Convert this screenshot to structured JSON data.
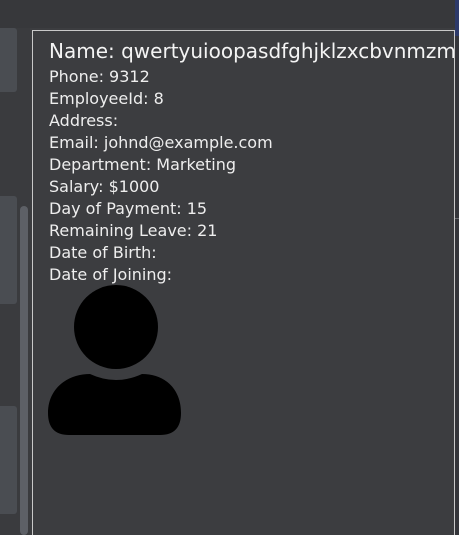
{
  "employee": {
    "name_label": "Name: ",
    "name": "qwertyuioopasdfghjklzxcbvnmzmzxcvbnmasdfghjkl",
    "fields": [
      {
        "label": "Phone: ",
        "value": "9312"
      },
      {
        "label": "EmployeeId: ",
        "value": "8"
      },
      {
        "label": "Address: ",
        "value": ""
      },
      {
        "label": "Email: ",
        "value": "johnd@example.com"
      },
      {
        "label": "Department: ",
        "value": "Marketing"
      },
      {
        "label": "Salary: ",
        "value": "$1000"
      },
      {
        "label": "Day of Payment: ",
        "value": "15"
      },
      {
        "label": "Remaining Leave: ",
        "value": "21"
      },
      {
        "label": "Date of Birth: ",
        "value": ""
      },
      {
        "label": "Date of Joining: ",
        "value": ""
      }
    ],
    "avatar_icon": "user-silhouette-icon"
  },
  "colors": {
    "background": "#3c3d40",
    "card_border": "#c9c9c9",
    "text": "#eeeeee",
    "avatar": "#000000"
  }
}
